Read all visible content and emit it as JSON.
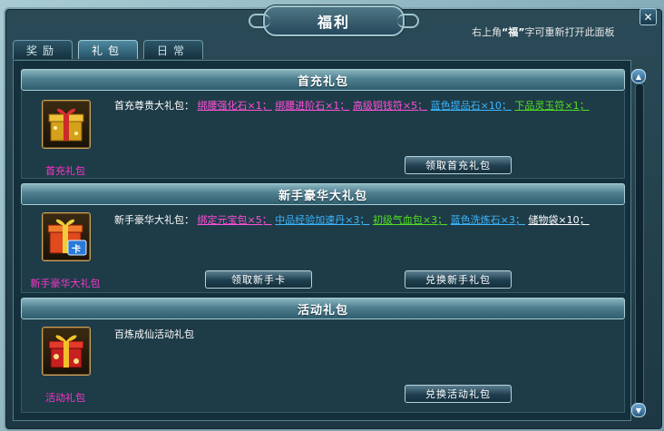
{
  "window": {
    "title": "福利",
    "close_label": "✕",
    "hint_prefix": "右上角",
    "hint_key": "“福”",
    "hint_suffix": "字可重新打开此面板"
  },
  "tabs": [
    {
      "label": "奖励",
      "active": false
    },
    {
      "label": "礼包",
      "active": true
    },
    {
      "label": "日常",
      "active": false
    }
  ],
  "sections": {
    "first_charge": {
      "header": "首充礼包",
      "name": "首充礼包",
      "desc_label": "首充尊贵大礼包：",
      "items": [
        {
          "text": "绑腰强化石×1；",
          "color": "#ff4fd8"
        },
        {
          "text": "绑腰进阶石×1；",
          "color": "#ff4fd8"
        },
        {
          "text": "高级铜钱符×5；",
          "color": "#ff4fd8"
        },
        {
          "text": "蓝色提品石×10；",
          "color": "#3bb6ff"
        },
        {
          "text": "下品灵玉符×1；",
          "color": "#52e020"
        }
      ],
      "button": "领取首充礼包"
    },
    "newbie": {
      "header": "新手豪华大礼包",
      "name": "新手豪华大礼包",
      "desc_label": "新手豪华大礼包：",
      "items": [
        {
          "text": "绑定元宝包×5；",
          "color": "#ff4fd8"
        },
        {
          "text": "中品经验加速丹×3；",
          "color": "#3bb6ff"
        },
        {
          "text": "初级气血包×3；",
          "color": "#52e020"
        },
        {
          "text": "蓝色洗炼石×3；",
          "color": "#3bb6ff"
        },
        {
          "text": "储物袋×10；",
          "color": "#ffffff"
        }
      ],
      "icon_card_label": "卡",
      "button_left": "领取新手卡",
      "button_right": "兑换新手礼包"
    },
    "activity": {
      "header": "活动礼包",
      "name": "活动礼包",
      "desc_label": "百炼成仙活动礼包",
      "button": "兑换活动礼包"
    }
  },
  "scroll": {
    "up": "▲",
    "down": "▼"
  }
}
